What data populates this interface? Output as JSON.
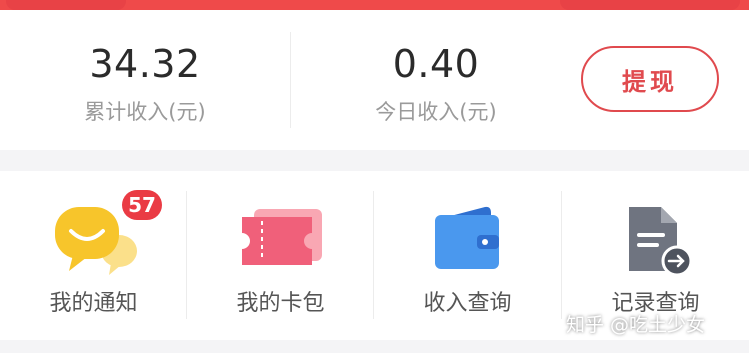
{
  "stats": {
    "total_income": {
      "value": "34.32",
      "label": "累计收入(元)"
    },
    "today_income": {
      "value": "0.40",
      "label": "今日收入(元)"
    },
    "withdraw_label": "提现"
  },
  "grid": {
    "items": [
      {
        "label": "我的通知",
        "icon": "chat-smile-icon",
        "badge": "57"
      },
      {
        "label": "我的卡包",
        "icon": "ticket-card-icon"
      },
      {
        "label": "收入查询",
        "icon": "wallet-icon"
      },
      {
        "label": "记录查询",
        "icon": "document-arrow-icon"
      }
    ]
  },
  "watermark": "知乎 @吃土少女",
  "colors": {
    "accent_red": "#e04a4e",
    "badge_red": "#ea3b44",
    "top_band": "#ef4a4a"
  }
}
